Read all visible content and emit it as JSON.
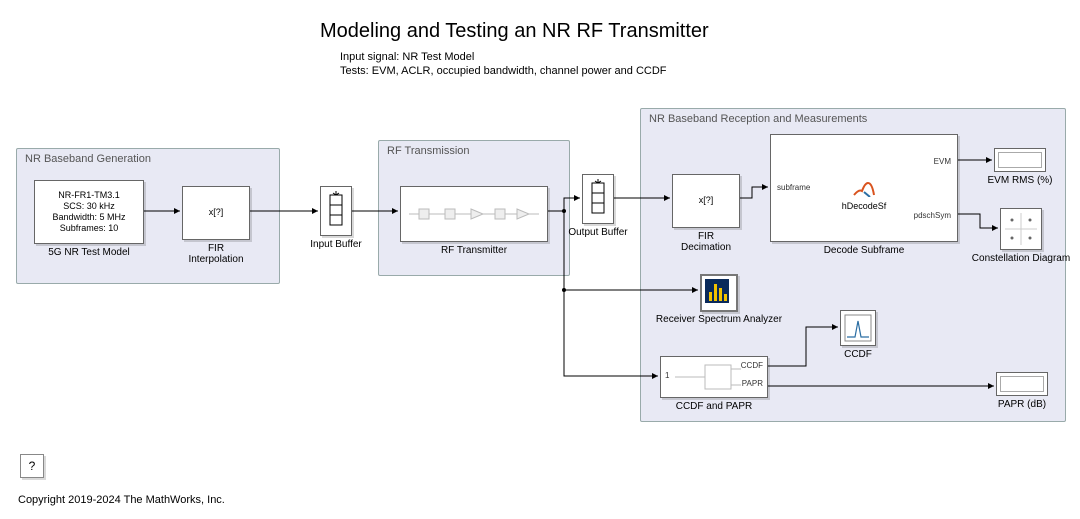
{
  "title": "Modeling and Testing an NR RF Transmitter",
  "subtitle_line1": "Input signal: NR Test Model",
  "subtitle_line2": "Tests: EVM, ACLR, occupied bandwidth, channel power and CCDF",
  "groups": {
    "baseband_gen": {
      "label": "NR Baseband Generation"
    },
    "rf_tx": {
      "label": "RF Transmission"
    },
    "reception": {
      "label": "NR Baseband Reception and Measurements"
    }
  },
  "blocks": {
    "test_model": {
      "label": "5G NR Test Model",
      "params": [
        "NR-FR1-TM3.1",
        "SCS: 30 kHz",
        "Bandwidth: 5 MHz",
        "Subframes: 10"
      ]
    },
    "fir_interp": {
      "label": "FIR Interpolation",
      "text": "x[?]"
    },
    "input_buffer": {
      "label": "Input Buffer"
    },
    "rf_transmitter": {
      "label": "RF Transmitter"
    },
    "output_buffer": {
      "label": "Output Buffer"
    },
    "fir_decim": {
      "label": "FIR Decimation",
      "text": "x[?]"
    },
    "decode_subframe": {
      "label": "Decode Subframe",
      "fn": "hDecodeSf",
      "port_in": "subframe",
      "port_out1": "EVM",
      "port_out2": "pdschSym"
    },
    "evm_display": {
      "label": "EVM RMS (%)"
    },
    "constellation": {
      "label": "Constellation Diagram"
    },
    "rx_spectrum": {
      "label": "Receiver Spectrum Analyzer"
    },
    "ccdf_display": {
      "label": "CCDF"
    },
    "ccdf_papr": {
      "label": "CCDF and PAPR",
      "port_in": "1",
      "port_out1": "CCDF",
      "port_out2": "PAPR"
    },
    "papr_display": {
      "label": "PAPR (dB)"
    }
  },
  "help": "?",
  "copyright": "Copyright 2019-2024 The MathWorks, Inc."
}
